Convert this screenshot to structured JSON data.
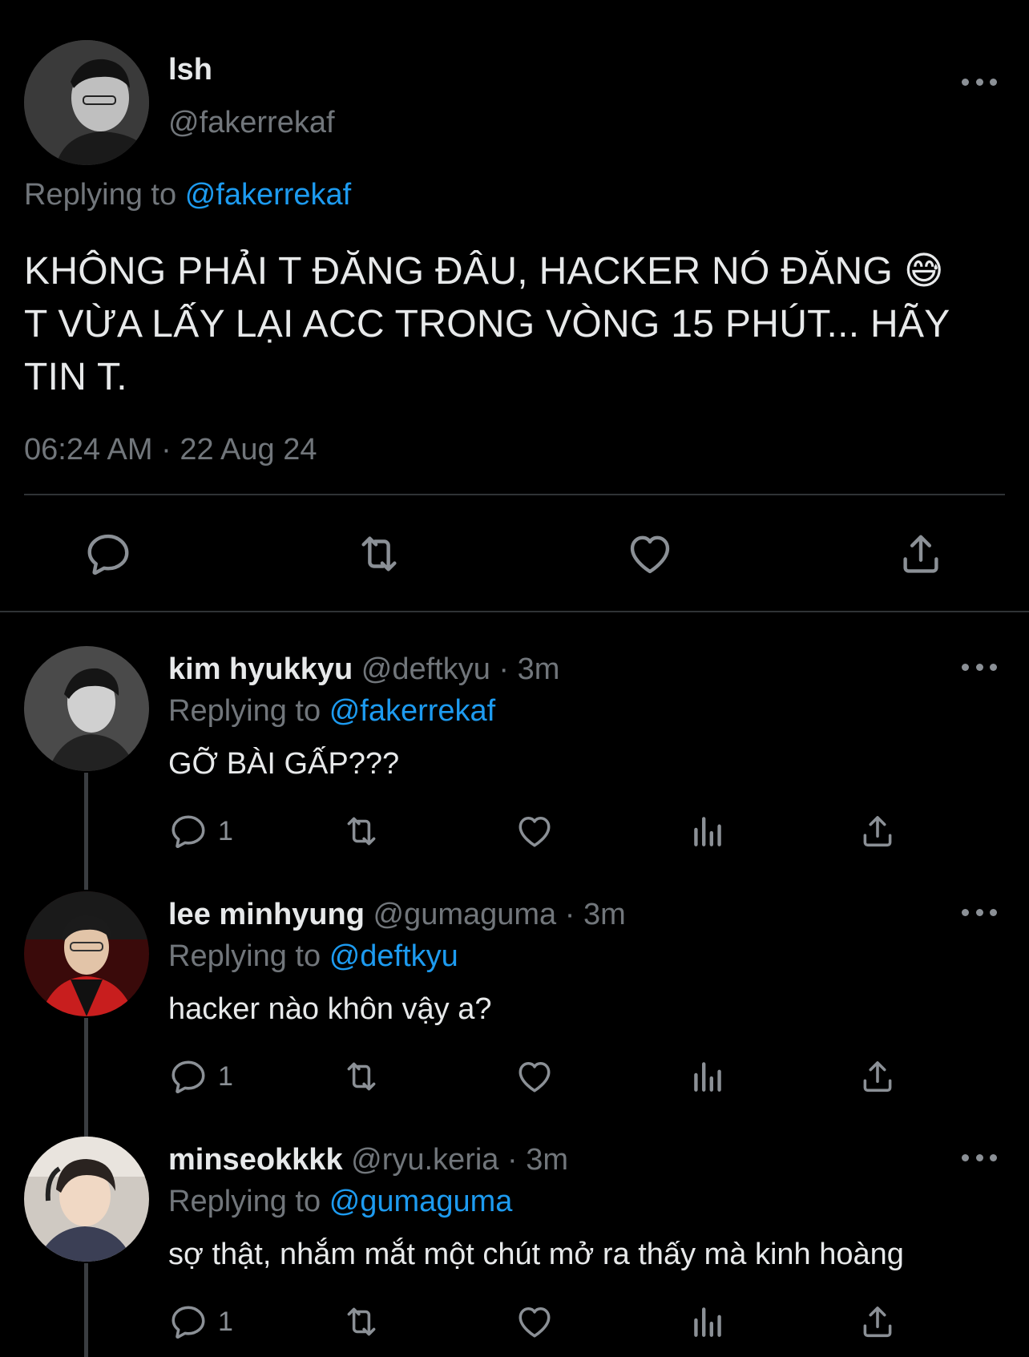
{
  "main_tweet": {
    "display_name": "lsh",
    "handle": "@fakerrekaf",
    "replying_label": "Replying to",
    "replying_to": "@fakerrekaf",
    "text_line1": "KHÔNG PHẢI T ĐĂNG ĐÂU, HACKER NÓ ĐĂNG 😅",
    "text_line2": "T VỪA LẤY LẠI ACC TRONG VÒNG 15 PHÚT... HÃY",
    "text_line3": "TIN T.",
    "timestamp": "06:24 AM · 22 Aug 24",
    "actions": [
      "reply-icon",
      "retweet-icon",
      "like-icon",
      "share-icon"
    ]
  },
  "replies": [
    {
      "display_name": "kim hyukkyu",
      "handle_time": "@deftkyu · 3m",
      "replying_label": "Replying to",
      "replying_to": "@fakerrekaf",
      "text": "GỠ BÀI GẤP???",
      "reply_count": "1"
    },
    {
      "display_name": "lee minhyung",
      "handle_time": "@gumaguma · 3m",
      "replying_label": "Replying to",
      "replying_to": "@deftkyu",
      "text": "hacker nào khôn vậy a?",
      "reply_count": "1"
    },
    {
      "display_name": "minseokkkk",
      "handle_time": "@ryu.keria · 3m",
      "replying_label": "Replying to",
      "replying_to": "@gumaguma",
      "text": "sợ thật, nhắm mắt một chút mở ra thấy mà kinh hoàng",
      "reply_count": "1"
    }
  ],
  "colors": {
    "background": "#000000",
    "text": "#e7e9ea",
    "secondary": "#71767b",
    "accent": "#1d9bf0",
    "divider": "#2f3336"
  }
}
